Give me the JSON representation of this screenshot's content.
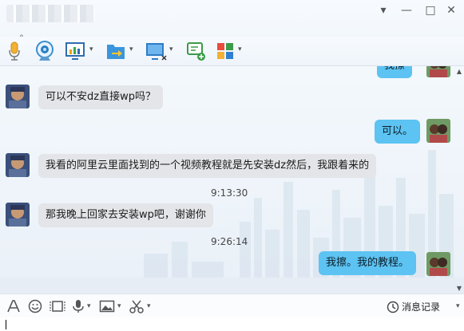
{
  "window": {
    "subtitle_dot": "。",
    "controls": {
      "menu": "▾",
      "minimize": "—",
      "maximize": "□",
      "close": "✕"
    }
  },
  "toolbar": {
    "buttons": [
      {
        "icon": "microphone-icon"
      },
      {
        "icon": "webcam-icon"
      },
      {
        "icon": "screen-share-icon"
      },
      {
        "icon": "send-file-icon"
      },
      {
        "icon": "remote-desktop-icon"
      },
      {
        "icon": "add-comment-icon"
      },
      {
        "icon": "apps-icon"
      }
    ]
  },
  "chat": {
    "messages": [
      {
        "type": "out",
        "text": "我擦"
      },
      {
        "type": "in",
        "text": "可以不安dz直接wp吗？"
      },
      {
        "type": "out",
        "text": "可以。"
      },
      {
        "type": "in",
        "text": "我看的阿里云里面找到的一个视频教程就是先安装dz然后，我跟着来的"
      },
      {
        "type": "time",
        "text": "9:13:30"
      },
      {
        "type": "in",
        "text": "那我晚上回家去安装wp吧，谢谢你"
      },
      {
        "type": "time",
        "text": "9:26:14"
      },
      {
        "type": "out",
        "text": "我擦。我的教程。"
      }
    ]
  },
  "inputbar": {
    "history_label": "消息记录",
    "history_arrow": "▾",
    "dropdown_arrow": "▾"
  },
  "colors": {
    "outgoing_bubble": "#5cc3f2",
    "incoming_bubble": "#e3e5e8"
  }
}
